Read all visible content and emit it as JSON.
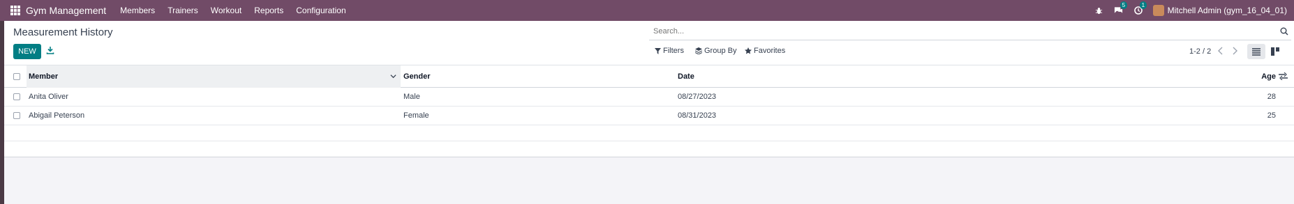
{
  "navbar": {
    "brand": "Gym Management",
    "menu": [
      "Members",
      "Trainers",
      "Workout",
      "Reports",
      "Configuration"
    ],
    "messages_count": "5",
    "activities_count": "1",
    "user_name": "Mitchell Admin (gym_16_04_01)"
  },
  "control_panel": {
    "title": "Measurement History",
    "new_label": "NEW",
    "search_placeholder": "Search...",
    "filters_label": "Filters",
    "group_by_label": "Group By",
    "favorites_label": "Favorites",
    "pager": "1-2 / 2"
  },
  "list": {
    "columns": {
      "member": "Member",
      "gender": "Gender",
      "date": "Date",
      "age": "Age"
    },
    "rows": [
      {
        "member": "Anita Oliver",
        "gender": "Male",
        "date": "08/27/2023",
        "age": "28"
      },
      {
        "member": "Abigail Peterson",
        "gender": "Female",
        "date": "08/31/2023",
        "age": "25"
      }
    ]
  },
  "colors": {
    "navbar": "#714b67",
    "primary": "#017e84"
  }
}
